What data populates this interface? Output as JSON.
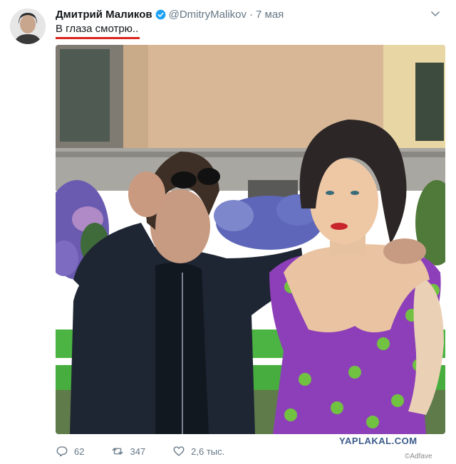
{
  "author": {
    "display_name": "Дмитрий Маликов",
    "handle": "@DmitryMalikov",
    "separator": "·",
    "time": "7 мая"
  },
  "tweet": {
    "text": "В глаза смотрю.."
  },
  "actions": {
    "replies": "62",
    "retweets": "347",
    "likes": "2,6 тыс."
  },
  "watermarks": {
    "site": "YAPLAKAL.COM",
    "adfave": "©Adfave"
  },
  "colors": {
    "verified": "#1da1f2",
    "underline": "#d9251d",
    "muted": "#657786"
  }
}
